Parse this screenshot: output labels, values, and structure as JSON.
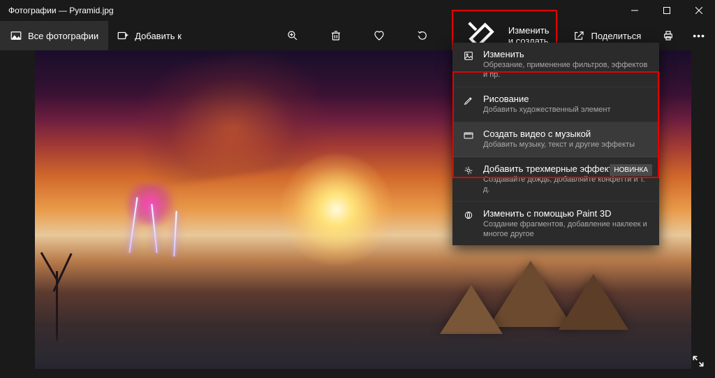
{
  "title": "Фотографии — Pyramid.jpg",
  "toolbar": {
    "all_photos": "Все фотографии",
    "add_to": "Добавить к",
    "edit_create": "Изменить и создать",
    "share": "Поделиться"
  },
  "menu": {
    "items": [
      {
        "title": "Изменить",
        "sub": "Обрезание, применение фильтров, эффектов и пр."
      },
      {
        "title": "Рисование",
        "sub": "Добавить художественный элемент"
      },
      {
        "title": "Создать видео с музыкой",
        "sub": "Добавить музыку, текст и другие эффекты"
      },
      {
        "title": "Добавить трехмерные эффекты",
        "sub": "Создавайте дождь, добавляйте конфетти и т. д.",
        "badge": "НОВИНКА"
      },
      {
        "title": "Изменить с помощью Paint 3D",
        "sub": "Создание фрагментов, добавление наклеек и многое другое"
      }
    ]
  }
}
